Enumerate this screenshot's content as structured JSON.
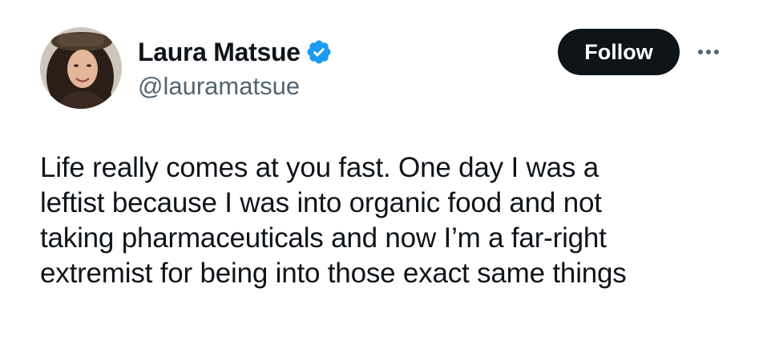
{
  "author": {
    "display_name": "Laura Matsue",
    "handle": "@lauramatsue",
    "verified": true,
    "verified_badge_color": "#1d9bf0",
    "avatar_icon": "profile-photo"
  },
  "actions": {
    "follow_label": "Follow",
    "more_icon": "ellipsis-icon"
  },
  "tweet": {
    "text_lines": [
      "Life really comes at you fast. One day I was a",
      "leftist because I was into organic food and not",
      "taking pharmaceuticals and now I’m a far-right",
      "extremist for being into those exact same things"
    ]
  },
  "colors": {
    "text": "#0f1419",
    "secondary_text": "#536471",
    "follow_bg": "#0f1419",
    "follow_text": "#ffffff"
  }
}
